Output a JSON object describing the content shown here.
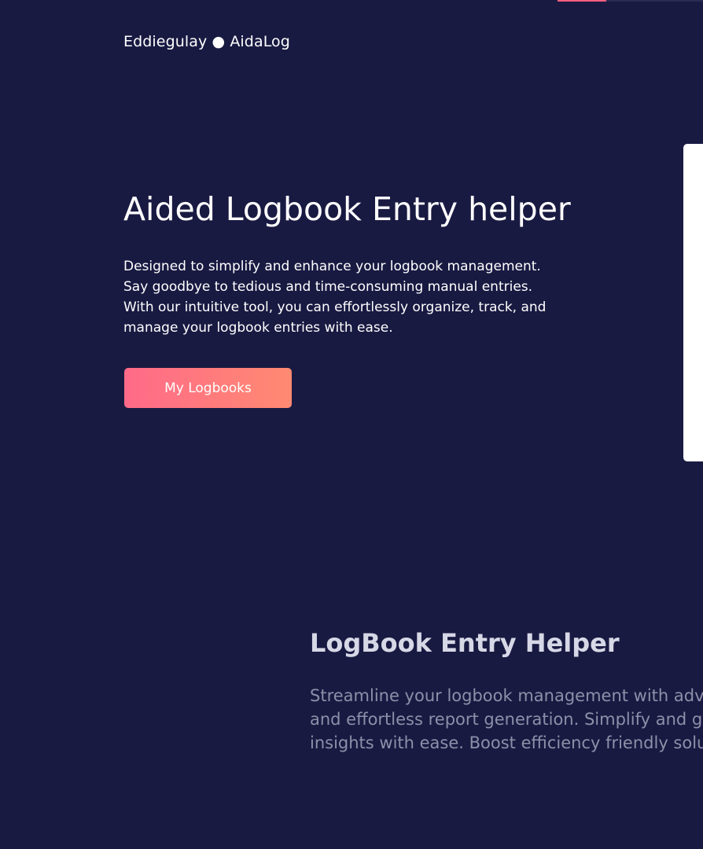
{
  "header": {
    "brand": "Eddiegulay ● AidaLog"
  },
  "hero": {
    "title": "Aided Logbook Entry helper",
    "description": "Designed to simplify and enhance your logbook management. Say goodbye to tedious and time-consuming manual entries. With our intuitive tool, you can effortlessly organize, track, and manage your logbook entries with ease.",
    "cta_label": "My Logbooks"
  },
  "feature": {
    "title": "LogBook Entry Helper",
    "description": "Streamline your logbook management with advanced prompts, and effortless report generation. Simplify and gain valuable insights with ease. Boost efficiency friendly solution"
  },
  "colors": {
    "background": "#191a42",
    "accent_start": "#ff6a88",
    "accent_end": "#ff8a72",
    "text_primary": "#ffffff",
    "text_muted": "#8e8fa8"
  }
}
